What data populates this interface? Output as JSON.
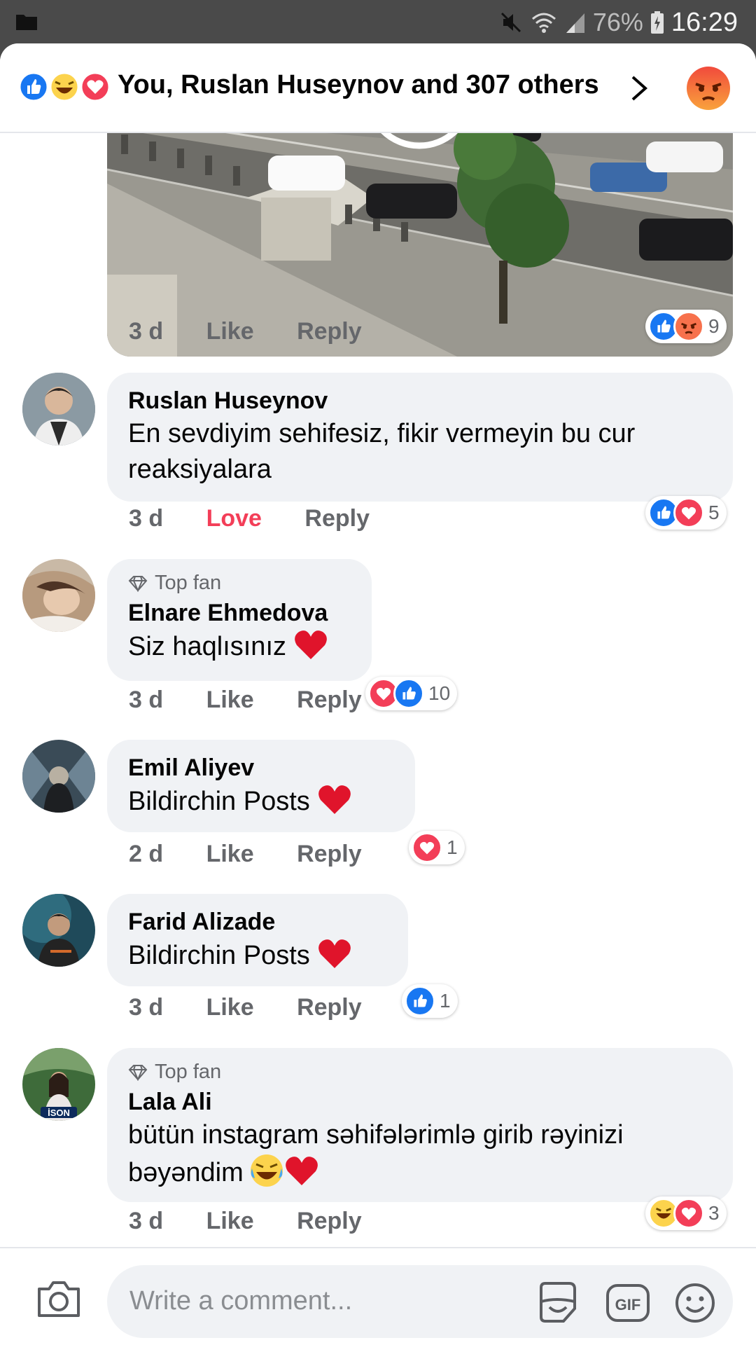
{
  "status": {
    "battery_pct": "76%",
    "time": "16:29"
  },
  "header": {
    "reactions_text": "You, Ruslan Huseynov and 307 others",
    "reaction_icons": [
      "like-icon",
      "haha-icon",
      "love-icon"
    ],
    "action_icon": "angry-icon"
  },
  "video_comment": {
    "time": "3 d",
    "like": "Like",
    "reply": "Reply",
    "reaction_count": "9"
  },
  "comments": [
    {
      "author": "Ruslan Huseynov",
      "top_fan": false,
      "text": "En sevdiyim sehifesiz, fikir vermeyin bu cur reaksiyalara",
      "time": "3 d",
      "like": "Love",
      "reply": "Reply",
      "reaction_count": "5",
      "reactions": [
        "like",
        "love"
      ]
    },
    {
      "author": "Elnare Ehmedova",
      "top_fan": true,
      "top_fan_label": "Top fan",
      "text": "Siz haqlısınız",
      "time": "3 d",
      "like": "Like",
      "reply": "Reply",
      "reaction_count": "10",
      "reactions": [
        "love",
        "like"
      ]
    },
    {
      "author": "Emil Aliyev",
      "top_fan": false,
      "text": "Bildirchin Posts",
      "time": "2 d",
      "like": "Like",
      "reply": "Reply",
      "reaction_count": "1",
      "reactions": [
        "love"
      ]
    },
    {
      "author": "Farid Alizade",
      "top_fan": false,
      "text": "Bildirchin Posts",
      "time": "3 d",
      "like": "Like",
      "reply": "Reply",
      "reaction_count": "1",
      "reactions": [
        "like"
      ]
    },
    {
      "author": "Lala Ali",
      "top_fan": true,
      "top_fan_label": "Top fan",
      "text": "bütün instagram səhifələrimlə girib rəyinizi bəyəndim",
      "time": "3 d",
      "like": "Like",
      "reply": "Reply",
      "reaction_count": "3",
      "reactions": [
        "haha",
        "love"
      ]
    }
  ],
  "composer": {
    "placeholder": "Write a comment..."
  },
  "colors": {
    "like": "#1877f2",
    "love": "#f33e58",
    "bubble": "#f0f2f5",
    "meta": "#65676b"
  }
}
